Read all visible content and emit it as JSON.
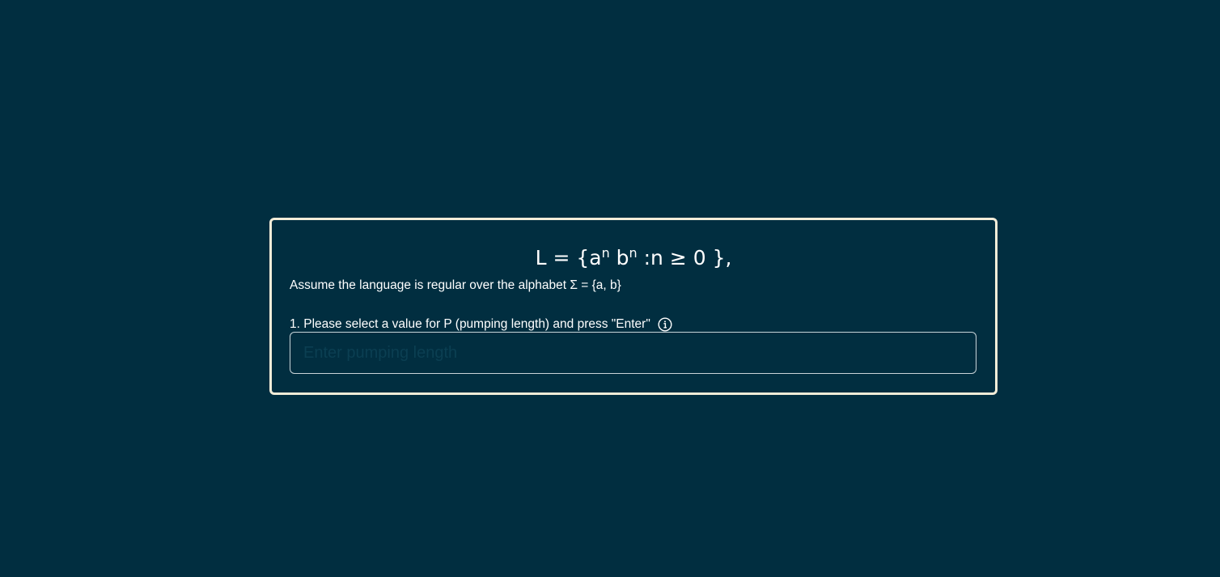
{
  "language": {
    "prefix": "L = {a",
    "sup1": "n",
    "middle": " b",
    "sup2": "n",
    "suffix": " :n ≥ 0 },"
  },
  "assumption": "Assume the language is regular over the alphabet Σ = {a, b}",
  "step1": {
    "label": "1. Please select a value for P (pumping length) and press \"Enter\"",
    "info_icon": "info-circle-icon",
    "input_value": "",
    "input_placeholder": "Enter pumping length"
  },
  "colors": {
    "background": "#012e40",
    "card_border": "#f2ecd8",
    "text": "#ffffff",
    "input_border": "#c9d4d8"
  }
}
